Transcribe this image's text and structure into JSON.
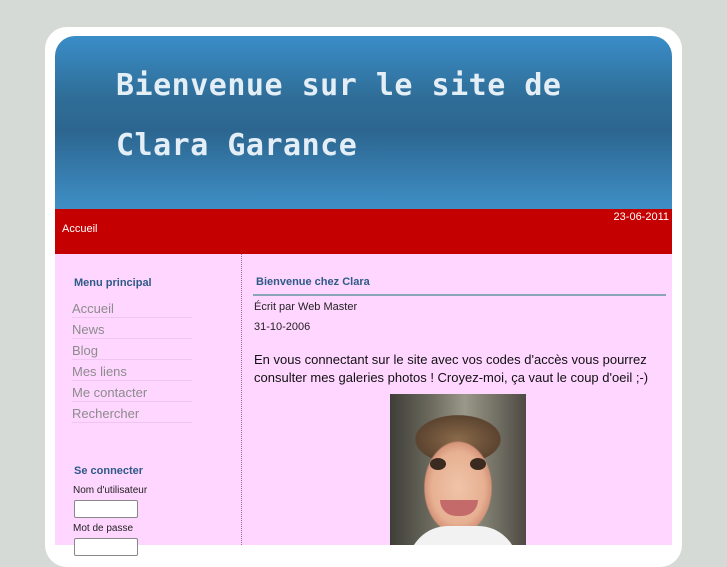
{
  "header": {
    "title": "Bienvenue sur le site de Clara Garance"
  },
  "navbar": {
    "date": "23-06-2011",
    "home_label": "Accueil"
  },
  "sidebar": {
    "menu_heading": "Menu principal",
    "menu_items": [
      "Accueil",
      "News",
      "Blog",
      "Mes liens",
      "Me contacter",
      "Rechercher"
    ],
    "login_heading": "Se connecter",
    "username_label": "Nom d'utilisateur",
    "password_label": "Mot de passe"
  },
  "article": {
    "title": "Bienvenue chez Clara",
    "author": "Écrit par Web Master",
    "date": "31-10-2006",
    "intro": "En vous connectant sur le site avec vos codes d'accès vous pourrez consulter mes galeries photos ! Croyez-moi, ça vaut le coup d'oeil ;-)"
  },
  "colors": {
    "header_blue": "#2f6e98",
    "nav_red": "#c40000",
    "content_pink": "#ffd6ff",
    "heading_blue": "#2e5a86"
  }
}
